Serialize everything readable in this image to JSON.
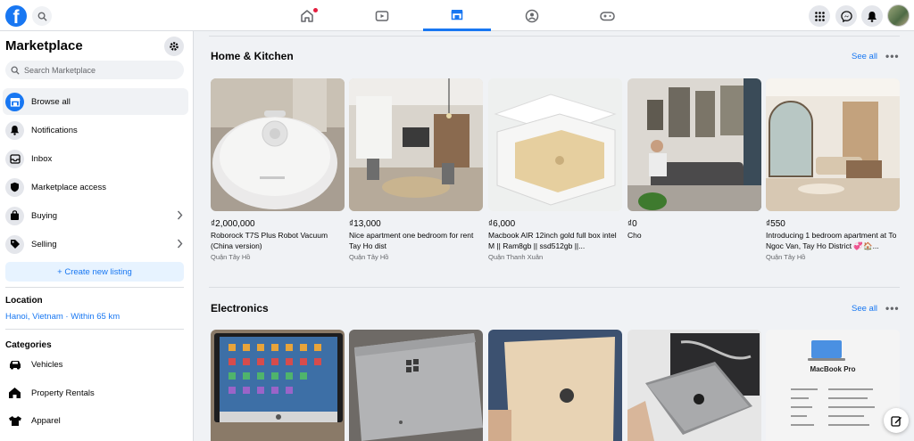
{
  "nav": {
    "logo": "f"
  },
  "sidebar": {
    "title": "Marketplace",
    "search_placeholder": "Search Marketplace",
    "items": [
      {
        "label": "Browse all",
        "icon": "storefront-icon"
      },
      {
        "label": "Notifications",
        "icon": "bell-icon"
      },
      {
        "label": "Inbox",
        "icon": "inbox-icon"
      },
      {
        "label": "Marketplace access",
        "icon": "shield-icon"
      },
      {
        "label": "Buying",
        "icon": "bag-icon"
      },
      {
        "label": "Selling",
        "icon": "tag-icon"
      }
    ],
    "create_label": "+ Create new listing",
    "location_head": "Location",
    "location_value": "Hanoi, Vietnam · Within 65 km",
    "categories_head": "Categories",
    "categories": [
      {
        "label": "Vehicles",
        "icon": "car-icon"
      },
      {
        "label": "Property Rentals",
        "icon": "house-icon"
      },
      {
        "label": "Apparel",
        "icon": "shirt-icon"
      }
    ]
  },
  "sections": [
    {
      "title": "Home & Kitchen",
      "see_all": "See all",
      "more": "•••",
      "cards": [
        {
          "price": "₫2,000,000",
          "title": "Roborock T7S Plus Robot Vacuum (China version)",
          "place": "Quận Tây Hồ"
        },
        {
          "price": "₫13,000",
          "title": "Nice apartment one bedroom for rent Tay Ho dist",
          "place": "Quận Tây Hồ"
        },
        {
          "price": "₫6,000",
          "title": "Macbook AIR 12inch gold full box intel M || Ram8gb || ssd512gb ||...",
          "place": "Quận Thanh Xuân"
        },
        {
          "price": "₫0",
          "title": "Cho",
          "place": ""
        },
        {
          "price": "₫550",
          "title": "Introducing 1 bedroom apartment at To Ngoc Van, Tay Ho District 💞🏠...",
          "place": "Quận Tây Hồ"
        }
      ]
    },
    {
      "title": "Electronics",
      "see_all": "See all",
      "more": "•••",
      "photo_texts": {
        "macbook_pro": "MacBook Pro"
      }
    }
  ],
  "colors": {
    "accent": "#1877f2",
    "notif": "#e41e3f"
  }
}
